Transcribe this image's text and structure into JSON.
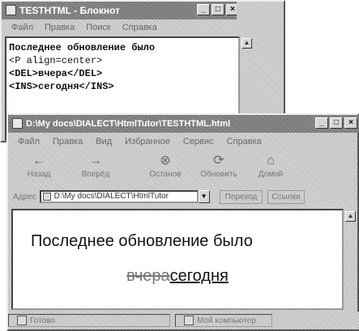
{
  "notepad": {
    "title": "TESTHTML - Блокнот",
    "menu": [
      "Файл",
      "Правка",
      "Поиск",
      "Справка"
    ],
    "lines": [
      {
        "text": "Последнее обновление было",
        "bold": true
      },
      {
        "text": "<P align=center>",
        "bold": false
      },
      {
        "text": "<DEL>вчера</DEL>",
        "bold": true
      },
      {
        "text": "<INS>сегодня</INS>",
        "bold": true
      }
    ]
  },
  "browser": {
    "title": "D:\\My docs\\DIALECT\\HtmlTutor\\TESTHTML.html",
    "menu": [
      "Файл",
      "Правка",
      "Вид",
      "Избранное",
      "Сервис",
      "Справка"
    ],
    "toolbar": [
      {
        "label": "Назад",
        "icon": "back-arrow-icon"
      },
      {
        "label": "Вперёд",
        "icon": "forward-arrow-icon"
      },
      {
        "label": "Останов",
        "icon": "stop-icon"
      },
      {
        "label": "Обновить",
        "icon": "refresh-icon"
      },
      {
        "label": "Домой",
        "icon": "home-icon"
      }
    ],
    "address_label": "Адрес",
    "address_value": "D:\\My docs\\DIALECT\\HtmlTutor",
    "go_label": "Переход",
    "links_label": "Ссылки",
    "content": {
      "line1": "Последнее обновление было",
      "deleted": "вчера",
      "inserted": "сегодня"
    },
    "status": {
      "left": "Готово",
      "zone": "Мой компьютер"
    }
  }
}
